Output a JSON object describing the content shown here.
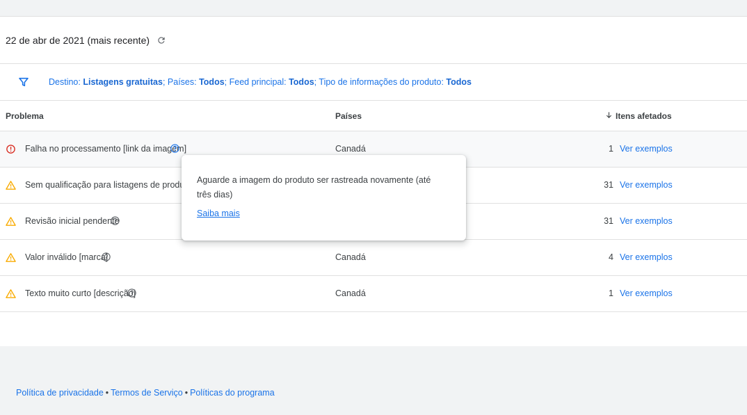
{
  "report": {
    "date_label": "22 de abr de 2021 (mais recente)",
    "filter": {
      "parts": [
        {
          "key": "Destino: ",
          "value": "Listagens gratuitas",
          "sep": "; "
        },
        {
          "key": "Países: ",
          "value": "Todos",
          "sep": "; "
        },
        {
          "key": "Feed principal: ",
          "value": "Todos",
          "sep": "; "
        },
        {
          "key": "Tipo de informações do produto: ",
          "value": "Todos",
          "sep": ""
        }
      ]
    }
  },
  "table": {
    "headers": {
      "problem": "Problema",
      "countries": "Países",
      "affected": "Itens afetados"
    },
    "rows": [
      {
        "status": "error",
        "problem": "Falha no processamento [link da imagem]",
        "country": "Canadá",
        "count": "1",
        "link": "Ver exemplos"
      },
      {
        "status": "warning",
        "problem": "Sem qualificação para listagens de produto av",
        "country": "",
        "count": "31",
        "link": "Ver exemplos"
      },
      {
        "status": "warning",
        "problem": "Revisão inicial pendente",
        "country": "",
        "count": "31",
        "link": "Ver exemplos"
      },
      {
        "status": "warning",
        "problem": "Valor inválido [marca]",
        "country": "Canadá",
        "count": "4",
        "link": "Ver exemplos"
      },
      {
        "status": "warning",
        "problem": "Texto muito curto [descrição]",
        "country": "Canadá",
        "count": "1",
        "link": "Ver exemplos"
      }
    ]
  },
  "tooltip": {
    "message": "Aguarde a imagem do produto ser rastreada novamente (até três dias)",
    "link": "Saiba mais"
  },
  "footer": {
    "links": [
      "Política de privacidade",
      "Termos de Serviço",
      "Políticas do programa"
    ],
    "separator": "•"
  },
  "colors": {
    "accent": "#1a73e8",
    "error": "#d93025",
    "warning": "#f9ab00"
  },
  "icons": {
    "refresh": "refresh-icon",
    "filter": "filter-icon",
    "error": "error-icon",
    "warning": "warning-icon",
    "help": "help-icon",
    "sort": "arrow-down-icon"
  }
}
